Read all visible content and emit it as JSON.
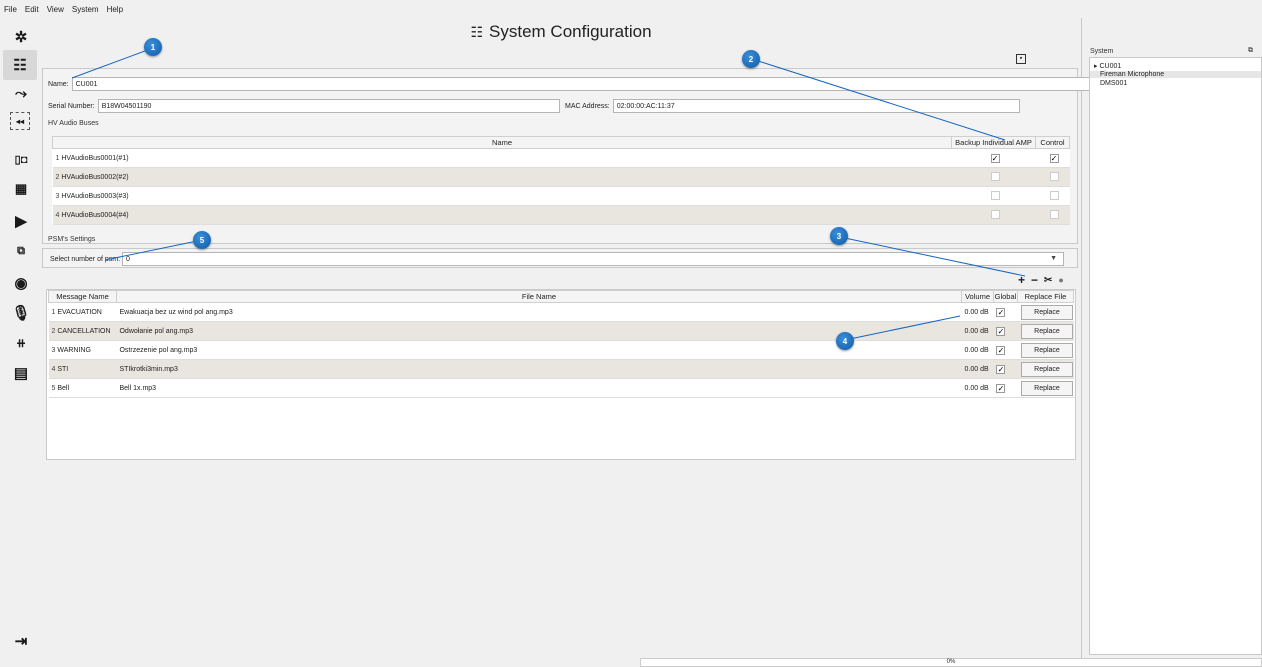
{
  "menu": [
    "File",
    "Edit",
    "View",
    "System",
    "Help"
  ],
  "title": "System Configuration",
  "fields": {
    "name_label": "Name:",
    "name_value": "CU001",
    "serial_label": "Serial Number:",
    "serial_value": "B18W04501190",
    "mac_label": "MAC Address:",
    "mac_value": "02:00:00:AC:11:37"
  },
  "hv_section": {
    "label": "HV Audio Buses",
    "headers": [
      "Name",
      "Backup Individual AMP",
      "Control"
    ],
    "rows": [
      {
        "num": "1",
        "name": "HVAudioBus0001(#1)",
        "backup": true,
        "control": true
      },
      {
        "num": "2",
        "name": "HVAudioBus0002(#2)",
        "backup": false,
        "control": false
      },
      {
        "num": "3",
        "name": "HVAudioBus0003(#3)",
        "backup": false,
        "control": false
      },
      {
        "num": "4",
        "name": "HVAudioBus0004(#4)",
        "backup": false,
        "control": false
      }
    ]
  },
  "psm": {
    "label": "PSM's Settings",
    "select_label": "Select number of psm:",
    "select_value": "0"
  },
  "messages": {
    "headers": [
      "Message Name",
      "File Name",
      "Volume",
      "Global",
      "Replace File"
    ],
    "rows": [
      {
        "num": "1",
        "name": "EVACUATION",
        "file": "Ewakuacja bez uz wind pol ang.mp3",
        "volume": "0.00 dB",
        "global": true,
        "button": "Replace"
      },
      {
        "num": "2",
        "name": "CANCELLATION",
        "file": "Odwołanie pol ang.mp3",
        "volume": "0.00 dB",
        "global": true,
        "button": "Replace"
      },
      {
        "num": "3",
        "name": "WARNING",
        "file": "Ostrzezenie pol ang.mp3",
        "volume": "0.00 dB",
        "global": true,
        "button": "Replace"
      },
      {
        "num": "4",
        "name": "STI",
        "file": "STIkrotki3min.mp3",
        "volume": "0.00 dB",
        "global": true,
        "button": "Replace"
      },
      {
        "num": "5",
        "name": "Bell",
        "file": "Bell 1x.mp3",
        "volume": "0.00 dB",
        "global": true,
        "button": "Replace"
      }
    ]
  },
  "callouts": [
    "1",
    "2",
    "3",
    "4",
    "5"
  ],
  "right_panel": {
    "title": "System",
    "items": [
      "CU001",
      "Fireman Microphone",
      "DMS001"
    ]
  },
  "status": {
    "progress_text": "0%",
    "progress": 0
  },
  "icons": {
    "sidebar": [
      "gear-icon",
      "system-config-icon",
      "routing-icon",
      "audio-zones-icon",
      "io-icon",
      "matrix-icon",
      "playlist-icon",
      "devices-icon",
      "monitor-icon",
      "microphone-icon",
      "amplifier-icon",
      "document-icon",
      "logout-icon"
    ]
  },
  "colors": {
    "callout": "#1565c0",
    "alt_row": "#e9e5df"
  }
}
